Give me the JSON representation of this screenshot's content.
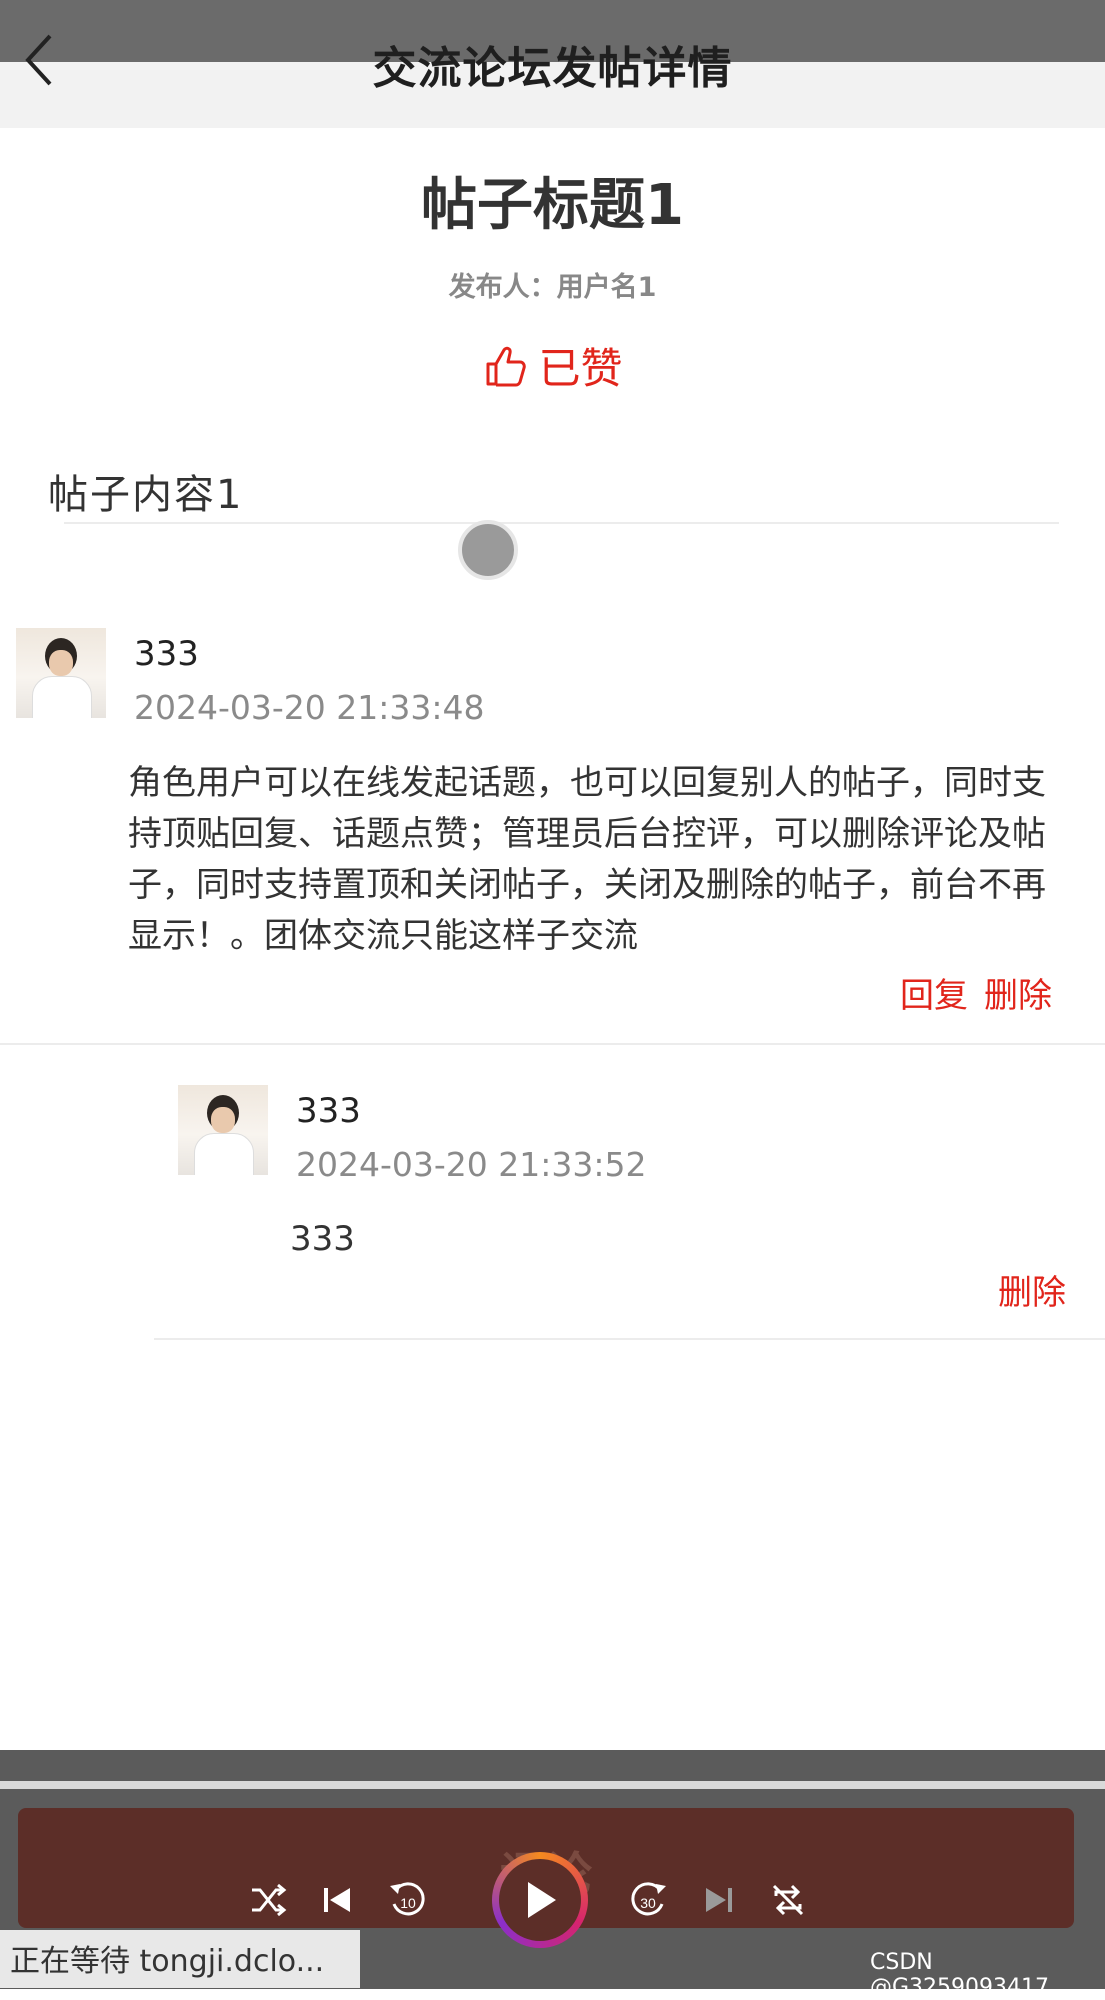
{
  "header": {
    "title": "交流论坛发帖详情"
  },
  "post": {
    "title": "帖子标题1",
    "author_line": "发布人：用户名1",
    "like_label": "已赞",
    "content": "帖子内容1"
  },
  "comments": [
    {
      "name": "333",
      "time": "2024-03-20 21:33:48",
      "text": "角色用户可以在线发起话题，也可以回复别人的帖子，同时支持顶贴回复、话题点赞；管理员后台控评，可以删除评论及帖子，同时支持置顶和关闭帖子，关闭及删除的帖子，前台不再显示！。团体交流只能这样子交流",
      "reply_label": "回复",
      "delete_label": "删除"
    },
    {
      "name": "333",
      "time": "2024-03-20 21:33:52",
      "text": "333",
      "delete_label": "删除"
    }
  ],
  "bottom": {
    "comment_button_label": "评论",
    "status_text": "正在等待 tongji.dclo...",
    "watermark": "CSDN @G3259093417"
  },
  "media_controls": {
    "icons": [
      "shuffle-icon",
      "previous-icon",
      "rewind-10-icon",
      "play-icon",
      "forward-30-icon",
      "next-icon",
      "repeat-icon"
    ],
    "rewind_label": "10",
    "forward_label": "30"
  },
  "colors": {
    "accent": "#e1251b",
    "comment_button": "#5c2e28",
    "topbar": "#6b6b6b"
  }
}
